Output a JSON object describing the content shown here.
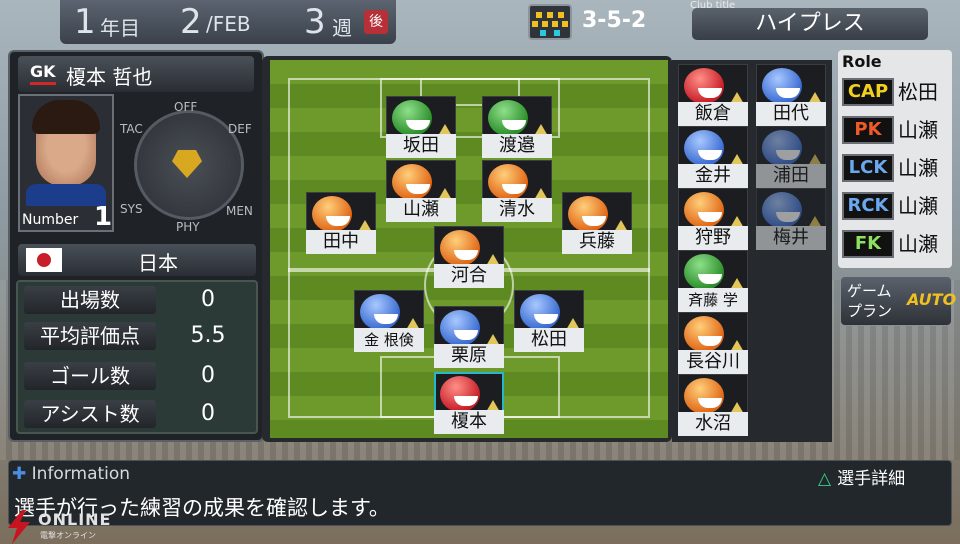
{
  "header": {
    "year_num": "1",
    "year_unit": "年目",
    "month_day": "2",
    "month_unit": "/FEB",
    "week_num": "3",
    "week_unit": "週",
    "week_badge": "後"
  },
  "formation": "3-5-2",
  "club": {
    "label": "Club title",
    "name": "ハイプレス"
  },
  "player": {
    "position": "GK",
    "name": "榎本 哲也",
    "number_label": "Number",
    "number": "1",
    "radar_labels": {
      "top": "OFF",
      "left": "TAC",
      "right": "DEF",
      "sys": "SYS",
      "men": "MEN",
      "bottom": "PHY"
    },
    "country": "日本"
  },
  "stats": [
    {
      "label": "出場数",
      "value": "0"
    },
    {
      "label": "平均評価点",
      "value": "5.5"
    },
    {
      "label": "ゴール数",
      "value": "0"
    },
    {
      "label": "アシスト数",
      "value": "0"
    }
  ],
  "pitch_players": [
    {
      "name": "坂田",
      "color": "green"
    },
    {
      "name": "渡邉",
      "color": "green"
    },
    {
      "name": "山瀬",
      "color": "orange"
    },
    {
      "name": "清水",
      "color": "orange"
    },
    {
      "name": "田中",
      "color": "orange"
    },
    {
      "name": "兵藤",
      "color": "orange"
    },
    {
      "name": "河合",
      "color": "orange"
    },
    {
      "name": "金 根倹",
      "color": "blue"
    },
    {
      "name": "松田",
      "color": "blue"
    },
    {
      "name": "栗原",
      "color": "blue"
    },
    {
      "name": "榎本",
      "color": "red"
    }
  ],
  "bench": [
    {
      "name": "飯倉",
      "color": "red"
    },
    {
      "name": "田代",
      "color": "blue"
    },
    {
      "name": "金井",
      "color": "blue"
    },
    {
      "name": "浦田",
      "color": "blue"
    },
    {
      "name": "狩野",
      "color": "orange"
    },
    {
      "name": "梅井",
      "color": "blue"
    },
    {
      "name": "斉藤 学",
      "color": "green"
    },
    {
      "name": "長谷川",
      "color": "orange"
    },
    {
      "name": "水沼",
      "color": "orange"
    }
  ],
  "roles": {
    "title": "Role",
    "items": [
      {
        "key": "CAP",
        "name": "松田",
        "color": "#f0d020"
      },
      {
        "key": "PK",
        "name": "山瀬",
        "color": "#f05a28"
      },
      {
        "key": "LCK",
        "name": "山瀬",
        "color": "#6aa8f0"
      },
      {
        "key": "RCK",
        "name": "山瀬",
        "color": "#6aa8f0"
      },
      {
        "key": "FK",
        "name": "山瀬",
        "color": "#8ee060"
      }
    ]
  },
  "gameplan": {
    "label": "ゲームプラン",
    "mode": "AUTO"
  },
  "info": {
    "title": "Information",
    "detail_button": "選手詳細",
    "message": "選手が行った練習の成果を確認します。"
  },
  "watermark": {
    "text": "ONLINE",
    "sub": "電撃オンライン"
  }
}
